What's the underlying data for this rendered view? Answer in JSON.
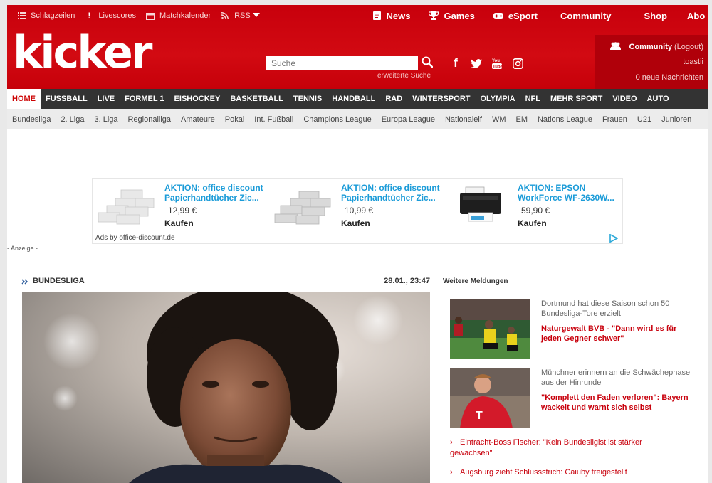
{
  "utility_nav": [
    {
      "label": "Schlagzeilen",
      "icon": "list-icon"
    },
    {
      "label": "Livescores",
      "icon": "exclamation-icon"
    },
    {
      "label": "Matchkalender",
      "icon": "calendar-icon"
    },
    {
      "label": "RSS",
      "icon": "rss-icon"
    }
  ],
  "main_nav": [
    {
      "label": "News",
      "icon": "news-icon"
    },
    {
      "label": "Games",
      "icon": "trophy-icon"
    },
    {
      "label": "eSport",
      "icon": "gamepad-icon"
    },
    {
      "label": "Community",
      "icon": ""
    },
    {
      "label": "Shop",
      "icon": ""
    },
    {
      "label": "Abo",
      "icon": ""
    }
  ],
  "logo": "kicker",
  "search": {
    "placeholder": "Suche",
    "advanced": "erweiterte Suche"
  },
  "community": {
    "label": "Community",
    "logout": "(Logout)",
    "user": "toastii",
    "messages": "0 neue Nachrichten"
  },
  "sport_nav": [
    "HOME",
    "FUSSBALL",
    "LIVE",
    "FORMEL 1",
    "EISHOCKEY",
    "BASKETBALL",
    "TENNIS",
    "HANDBALL",
    "RAD",
    "WINTERSPORT",
    "OLYMPIA",
    "NFL",
    "MEHR SPORT",
    "VIDEO",
    "AUTO"
  ],
  "sub_nav": [
    "Bundesliga",
    "2. Liga",
    "3. Liga",
    "Regionalliga",
    "Amateure",
    "Pokal",
    "Int. Fußball",
    "Champions League",
    "Europa League",
    "Nationalelf",
    "WM",
    "EM",
    "Nations League",
    "Frauen",
    "U21",
    "Junioren"
  ],
  "ad": {
    "items": [
      {
        "title": "AKTION: office discount Papierhandtücher Zic...",
        "price": "12,99 €",
        "buy": "Kaufen"
      },
      {
        "title": "AKTION: office discount Papierhandtücher Zic...",
        "price": "10,99 €",
        "buy": "Kaufen"
      },
      {
        "title": "AKTION: EPSON WorkForce WF-2630W...",
        "price": "59,90 €",
        "buy": "Kaufen"
      }
    ],
    "by": "Ads by office-discount.de",
    "label": "- Anzeige -"
  },
  "main_story": {
    "section": "BUNDESLIGA",
    "time": "28.01., 23:47"
  },
  "sidebar": {
    "heading": "Weitere Meldungen",
    "news": [
      {
        "kicker": "Dortmund hat diese Saison schon 50 Bundesliga-Tore erzielt",
        "headline": "Naturgewalt BVB - \"Dann wird es für jeden Gegner schwer\""
      },
      {
        "kicker": "Münchner erinnern an die Schwächephase aus der Hinrunde",
        "headline": "\"Komplett den Faden verloren\": Bayern wackelt und warnt sich selbst"
      }
    ],
    "links": [
      "Eintracht-Boss Fischer: \"Kein Bundesligist ist stärker gewachsen\"",
      "Augsburg zieht Schlussstrich: Caiuby freigestellt"
    ]
  },
  "colors": {
    "brand_red": "#c8000c",
    "nav_dark": "#333333",
    "ad_blue": "#1a9bd8"
  }
}
